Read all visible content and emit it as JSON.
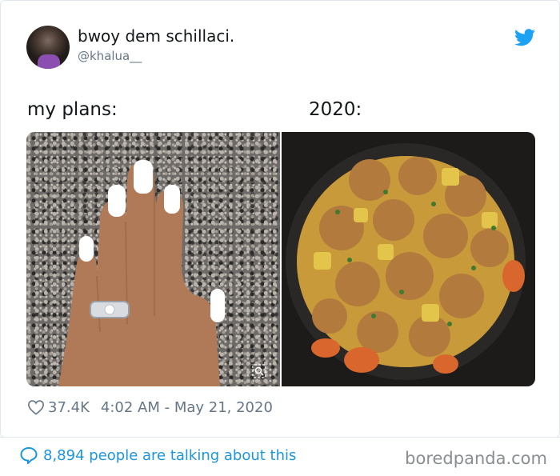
{
  "tweet": {
    "display_name": "bwoy dem schillaci.",
    "handle": "@khalua__",
    "caption_left": "my plans:",
    "caption_right": "2020:",
    "likes": "37.4K",
    "timestamp": "4:02 AM - May 21, 2020"
  },
  "images": [
    {
      "content": "manicured hand with white nails and diamond ring"
    },
    {
      "content": "pot of chicken curry with potatoes and carrots"
    }
  ],
  "footer": {
    "talking": "8,894 people are talking about this",
    "watermark": "boredpanda.com"
  },
  "icons": {
    "brand": "twitter-bird-icon",
    "like": "heart-icon",
    "conversation": "speech-bubble-icon",
    "zoom": "zoom-icon"
  },
  "colors": {
    "twitter_blue": "#1da1f2",
    "link_blue": "#1b95e0",
    "muted_text": "#657786",
    "primary_text": "#14171a"
  }
}
